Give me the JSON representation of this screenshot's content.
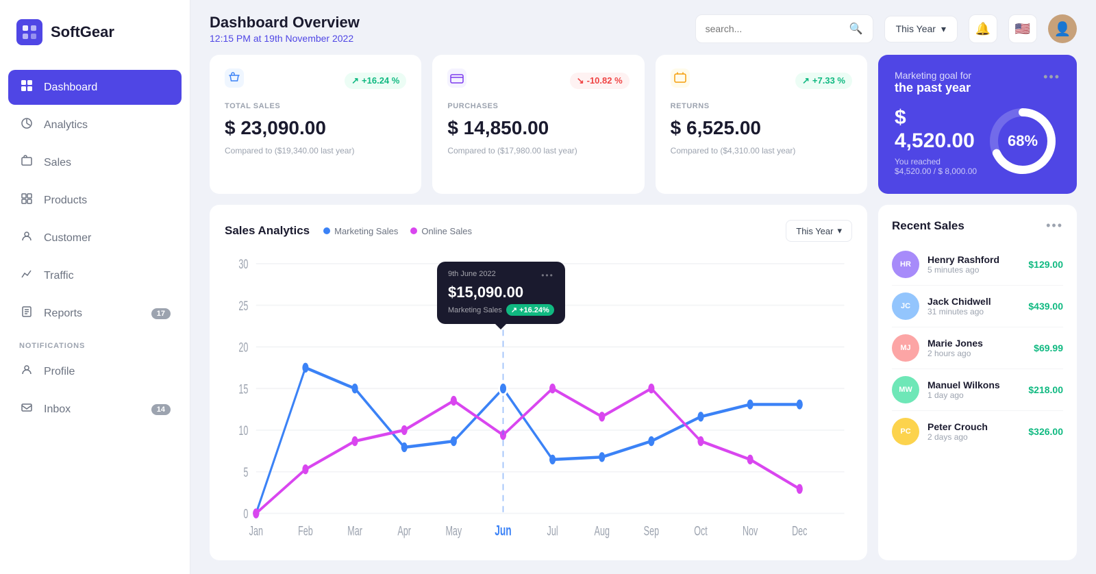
{
  "app": {
    "name": "SoftGear"
  },
  "sidebar": {
    "nav_items": [
      {
        "id": "dashboard",
        "label": "Dashboard",
        "icon": "⊞",
        "active": true,
        "badge": null
      },
      {
        "id": "analytics",
        "label": "Analytics",
        "icon": "◷",
        "active": false,
        "badge": null
      },
      {
        "id": "sales",
        "label": "Sales",
        "icon": "▤",
        "active": false,
        "badge": null
      },
      {
        "id": "products",
        "label": "Products",
        "icon": "⊡",
        "active": false,
        "badge": null
      },
      {
        "id": "customer",
        "label": "Customer",
        "icon": "⊟",
        "active": false,
        "badge": null
      },
      {
        "id": "traffic",
        "label": "Traffic",
        "icon": "⬚",
        "active": false,
        "badge": null
      },
      {
        "id": "reports",
        "label": "Reports",
        "icon": "⊞",
        "active": false,
        "badge": "17"
      }
    ],
    "notifications_label": "NOTIFICATIONS",
    "notification_items": [
      {
        "id": "profile",
        "label": "Profile",
        "icon": "👤",
        "badge": null
      },
      {
        "id": "inbox",
        "label": "Inbox",
        "icon": "📥",
        "badge": "14"
      }
    ]
  },
  "header": {
    "title": "Dashboard Overview",
    "subtitle": "12:15 PM at 19th November 2022",
    "search_placeholder": "search...",
    "filter_label": "This Year",
    "chevron_down": "▾"
  },
  "stats": [
    {
      "id": "total-sales",
      "icon": "🛒",
      "badge_text": "+16.24 %",
      "badge_type": "positive",
      "label": "TOTAL SALES",
      "value": "$ 23,090.00",
      "compare": "Compared to ($19,340.00 last year)"
    },
    {
      "id": "purchases",
      "icon": "💳",
      "badge_text": "-10.82 %",
      "badge_type": "negative",
      "label": "PURCHASES",
      "value": "$ 14,850.00",
      "compare": "Compared to ($17,980.00 last year)"
    },
    {
      "id": "returns",
      "icon": "🎫",
      "badge_text": "+7.33 %",
      "badge_type": "positive",
      "label": "RETURNS",
      "value": "$ 6,525.00",
      "compare": "Compared to ($4,310.00 last year)"
    }
  ],
  "marketing_goal": {
    "title": "Marketing goal for",
    "subtitle": "the past year",
    "amount": "$ 4,520.00",
    "percentage": 68,
    "percentage_label": "68%",
    "footer_label": "You reached",
    "footer_value": "$4,520.00 / $ 8,000.00"
  },
  "chart": {
    "title": "Sales Analytics",
    "legend": [
      {
        "label": "Marketing Sales",
        "color": "#3b82f6"
      },
      {
        "label": "Online Sales",
        "color": "#d946ef"
      }
    ],
    "filter_label": "This Year",
    "x_labels": [
      "Jan",
      "Feb",
      "Mar",
      "Apr",
      "May",
      "Jun",
      "Jul",
      "Aug",
      "Sep",
      "Oct",
      "Nov",
      "Dec"
    ],
    "y_labels": [
      "0",
      "5",
      "10",
      "15",
      "20",
      "25",
      "30"
    ],
    "tooltip": {
      "date": "9th June 2022",
      "amount": "$15,090.00",
      "label": "Marketing Sales",
      "badge": "+16.24%"
    }
  },
  "recent_sales": {
    "title": "Recent Sales",
    "items": [
      {
        "name": "Henry Rashford",
        "time": "5 minutes ago",
        "amount": "$129.00",
        "initials": "HR",
        "color": "#a78bfa"
      },
      {
        "name": "Jack Chidwell",
        "time": "31 minutes ago",
        "amount": "$439.00",
        "initials": "JC",
        "color": "#93c5fd"
      },
      {
        "name": "Marie Jones",
        "time": "2 hours ago",
        "amount": "$69.99",
        "initials": "MJ",
        "color": "#fca5a5"
      },
      {
        "name": "Manuel Wilkons",
        "time": "1 day ago",
        "amount": "$218.00",
        "initials": "MW",
        "color": "#6ee7b7"
      },
      {
        "name": "Peter Crouch",
        "time": "2 days ago",
        "amount": "$326.00",
        "initials": "PC",
        "color": "#fcd34d"
      }
    ]
  }
}
